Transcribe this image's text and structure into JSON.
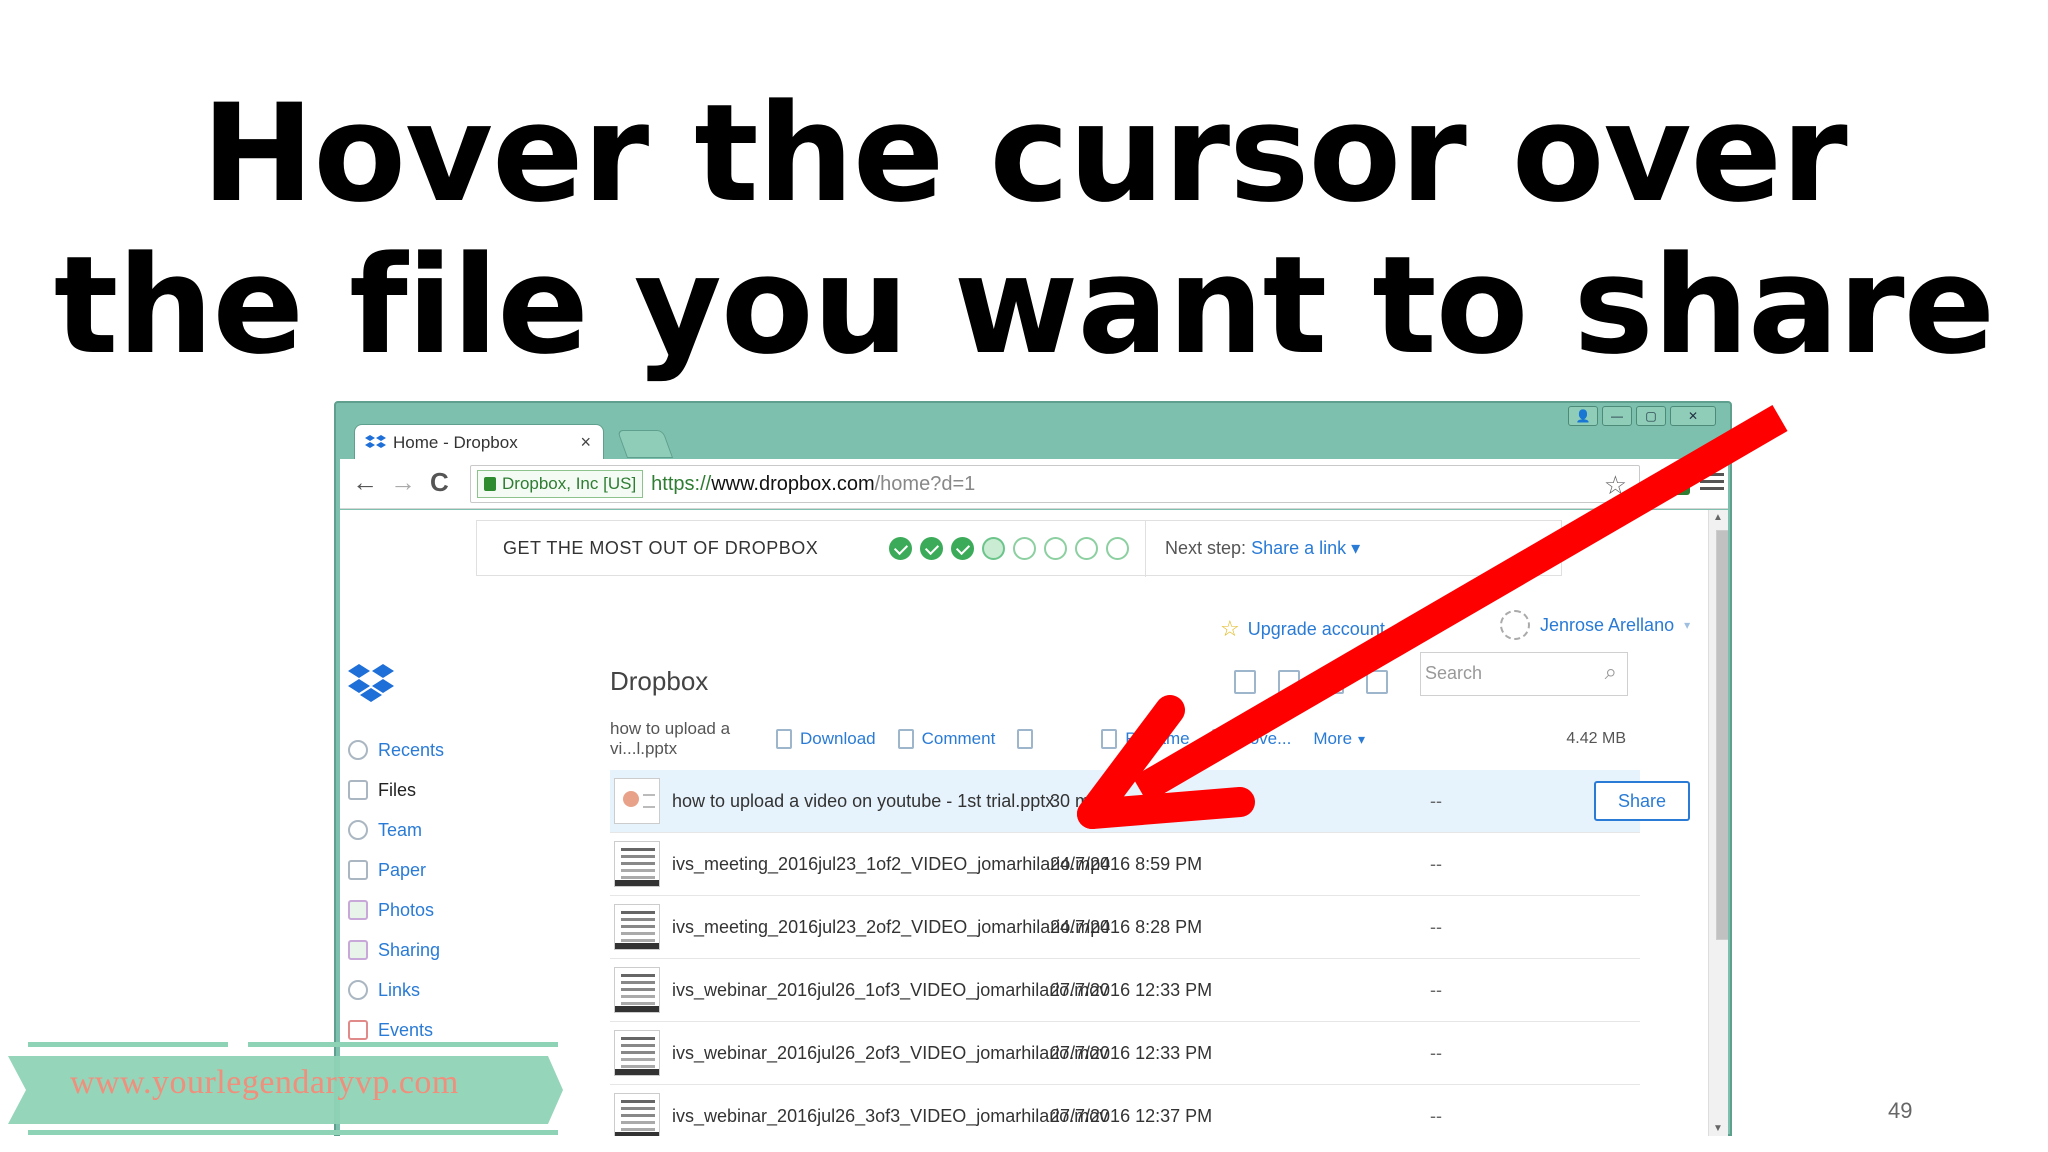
{
  "slide": {
    "title_line1": "Hover the cursor over",
    "title_line2": "the file you want to share",
    "page_number": "49",
    "watermark": "www.yourlegendaryvp.com"
  },
  "browser": {
    "tab_title": "Home - Dropbox",
    "tab_close": "×",
    "window_controls": [
      "user",
      "minimize",
      "maximize",
      "close"
    ],
    "ev_label": "Dropbox, Inc [US]",
    "url_scheme": "https://",
    "url_host": "www.dropbox.com",
    "url_path": "/home?d=1",
    "back": "←",
    "forward": "→",
    "reload": "C"
  },
  "promo": {
    "title": "GET THE MOST OUT OF DROPBOX",
    "steps_done": 3,
    "steps_total": 8,
    "next_label": "Next step:",
    "next_link": "Share a link ▾"
  },
  "account": {
    "upgrade": "Upgrade account",
    "user": "Jenrose Arellano",
    "caret": "▾"
  },
  "main": {
    "heading": "Dropbox",
    "search_placeholder": "Search"
  },
  "sidebar": {
    "items": [
      {
        "label": "Recents",
        "icon": "clock-icon"
      },
      {
        "label": "Files",
        "icon": "file-icon",
        "active": true
      },
      {
        "label": "Team",
        "icon": "team-icon"
      },
      {
        "label": "Paper",
        "icon": "paper-icon"
      },
      {
        "label": "Photos",
        "icon": "photos-icon"
      },
      {
        "label": "Sharing",
        "icon": "sharing-icon"
      },
      {
        "label": "Links",
        "icon": "link-icon"
      },
      {
        "label": "Events",
        "icon": "calendar-icon"
      }
    ]
  },
  "actions": {
    "selected": "how to upload a vi...l.pptx",
    "download": "Download",
    "comment": "Comment",
    "rename": "Rename",
    "move": "Move...",
    "more": "More",
    "size": "4.42 MB"
  },
  "files": [
    {
      "name": "how to upload a video on youtube - 1st trial.pptx",
      "modified": "30 mins ago",
      "members": "--",
      "type": "ppt",
      "hover": true,
      "share": "Share"
    },
    {
      "name": "ivs_meeting_2016jul23_1of2_VIDEO_jomarhilario.mp4",
      "modified": "24/7/2016 8:59 PM",
      "members": "--",
      "type": "vid"
    },
    {
      "name": "ivs_meeting_2016jul23_2of2_VIDEO_jomarhilario.mp4",
      "modified": "24/7/2016 8:28 PM",
      "members": "--",
      "type": "vid"
    },
    {
      "name": "ivs_webinar_2016jul26_1of3_VIDEO_jomarhilario.mov",
      "modified": "27/7/2016 12:33 PM",
      "members": "--",
      "type": "vid"
    },
    {
      "name": "ivs_webinar_2016jul26_2of3_VIDEO_jomarhilario.mov",
      "modified": "27/7/2016 12:33 PM",
      "members": "--",
      "type": "vid"
    },
    {
      "name": "ivs_webinar_2016jul26_3of3_VIDEO_jomarhilario.mov",
      "modified": "27/7/2016 12:37 PM",
      "members": "--",
      "type": "vid"
    }
  ],
  "colors": {
    "window_frame": "#7ec0ae",
    "link_blue": "#2a7bd6",
    "arrow_red": "#ff0000",
    "hover_row": "#e6f2fc",
    "banner_green": "#8fd3b6",
    "watermark_text": "#f08f7c"
  }
}
